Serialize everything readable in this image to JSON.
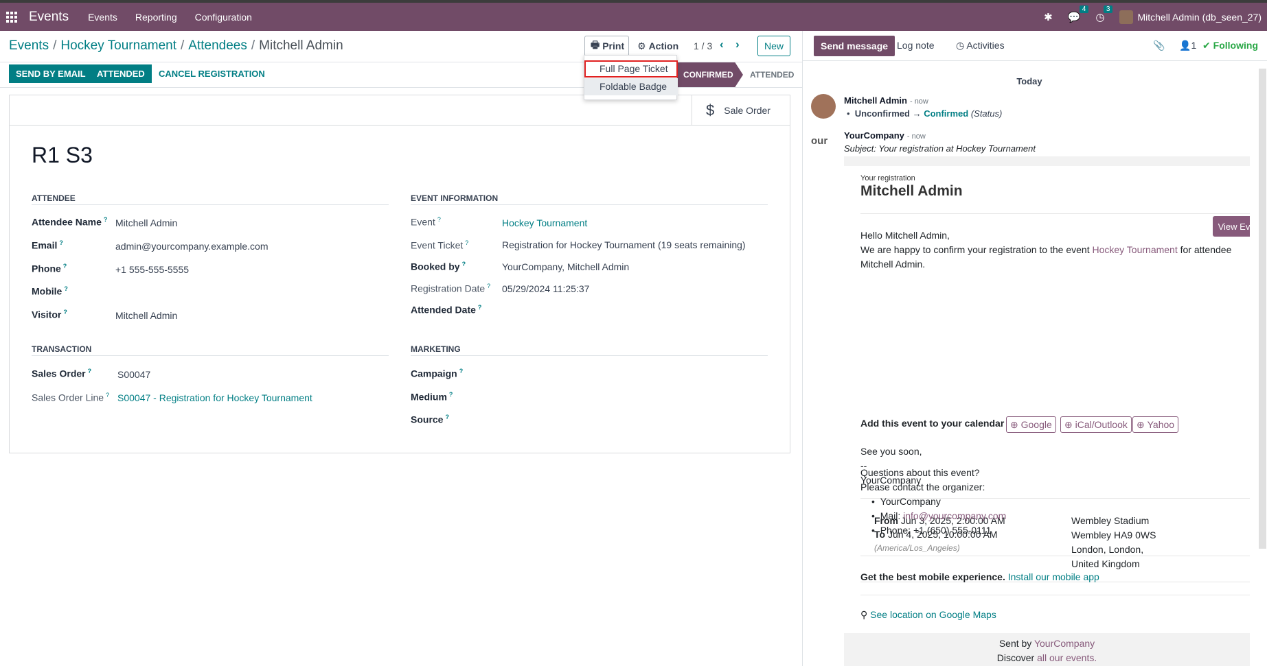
{
  "navbar": {
    "app_name": "Events",
    "menus": [
      "Events",
      "Reporting",
      "Configuration"
    ],
    "chat_count": "4",
    "activity_count": "3",
    "user": "Mitchell Admin (db_seen_27)"
  },
  "breadcrumb": {
    "items": [
      "Events",
      "Hockey Tournament",
      "Attendees"
    ],
    "current": "Mitchell Admin",
    "sep": "/"
  },
  "toolbar": {
    "print_label": "Print",
    "action_label": "Action",
    "pager": "1 / 3",
    "new_label": "New"
  },
  "print_menu": {
    "items": [
      "Full Page Ticket",
      "Foldable Badge"
    ]
  },
  "statusbar": {
    "send_email": "SEND BY EMAIL",
    "attended": "ATTENDED",
    "cancel": "CANCEL REGISTRATION",
    "stages": [
      "CONFIRMED",
      "ATTENDED"
    ]
  },
  "sheet": {
    "smart_button": "Sale Order",
    "title": "R1 S3",
    "attendee_group": "ATTENDEE",
    "event_group": "EVENT INFORMATION",
    "transaction_group": "TRANSACTION",
    "marketing_group": "MARKETING",
    "attendee_fields": [
      {
        "label": "Attendee Name",
        "value": "Mitchell Admin"
      },
      {
        "label": "Email",
        "value": "admin@yourcompany.example.com"
      },
      {
        "label": "Phone",
        "value": "+1 555-555-5555"
      },
      {
        "label": "Mobile",
        "value": ""
      },
      {
        "label": "Visitor",
        "value": "Mitchell Admin"
      }
    ],
    "event_fields": [
      {
        "label": "Event",
        "value": "Hockey Tournament"
      },
      {
        "label": "Event Ticket",
        "value": "Registration for Hockey Tournament (19 seats remaining)"
      },
      {
        "label": "Booked by",
        "value": "YourCompany, Mitchell Admin"
      },
      {
        "label": "Registration Date",
        "value": "05/29/2024 11:25:37"
      },
      {
        "label": "Attended Date",
        "value": ""
      }
    ],
    "transaction_fields": [
      {
        "label": "Sales Order",
        "value": "S00047"
      },
      {
        "label": "Sales Order Line",
        "value": "S00047 - Registration for Hockey Tournament"
      }
    ],
    "marketing_fields": [
      {
        "label": "Campaign"
      },
      {
        "label": "Medium"
      },
      {
        "label": "Source"
      }
    ]
  },
  "chatter": {
    "send_message": "Send message",
    "log_note": "Log note",
    "activities": "Activities",
    "followers": "1",
    "following": "Following",
    "today": "Today",
    "msg1_author": "Mitchell Admin",
    "msg1_time": "- now",
    "msg1_from": "Unconfirmed",
    "msg1_to": "Confirmed",
    "msg1_field": "(Status)",
    "msg2_author": "YourCompany",
    "msg2_time": "- now",
    "msg2_subject": "Subject: Your registration at Hockey Tournament",
    "msg2_logo_fragment": "our"
  },
  "email": {
    "small_header": "Your registration",
    "name": "Mitchell Admin",
    "view_event": "View Event",
    "greeting": "Hello Mitchell Admin,",
    "line1_a": "We are happy to confirm your registration to the event",
    "line1_link": "Hockey Tournament",
    "line1_b": "for attendee",
    "line2": "Mitchell Admin.",
    "add_calendar": "Add this event to your calendar",
    "cal_google": "Google",
    "cal_ical": "iCal/Outlook",
    "cal_yahoo": "Yahoo",
    "see_you": "See you soon,",
    "dashes": "--",
    "signature": "YourCompany",
    "from_label": "From",
    "from_value": "Jun 3, 2025, 2:00:00 AM",
    "to_label": "To",
    "to_value": "Jun 4, 2025, 10:00:00 AM",
    "tz": "(America/Los_Angeles)",
    "addr1": "Wembley Stadium",
    "addr2": "Wembley HA9 0WS",
    "addr3": "London, London,",
    "addr4": "United Kingdom",
    "questions": "Questions about this event?",
    "contact": "Please contact the organizer:",
    "org": "YourCompany",
    "mail_label": "Mail:",
    "mail_value": "info@yourcompany.com",
    "phone": "Phone: +1 (650) 555-0111",
    "mobile_bold": "Get the best mobile experience.",
    "mobile_link": "Install our mobile app",
    "maps": "See location on Google Maps",
    "sent_by": "Sent by",
    "sent_by_link": "YourCompany",
    "discover": "Discover",
    "discover_link": "all our events."
  }
}
